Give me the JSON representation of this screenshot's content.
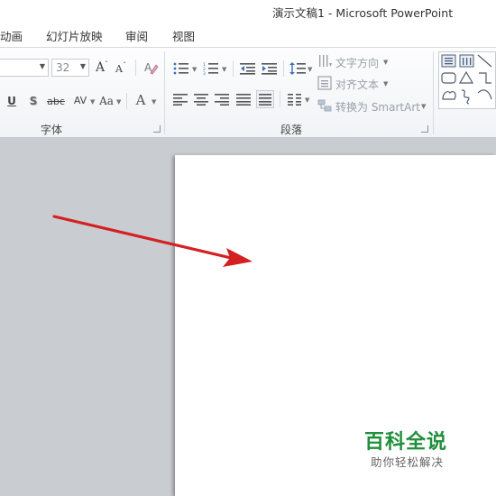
{
  "window": {
    "title": "演示文稿1 - Microsoft PowerPoint"
  },
  "tabs": [
    "动画",
    "幻灯片放映",
    "审阅",
    "视图"
  ],
  "font_group": {
    "label": "字体",
    "font_size": "32",
    "grow_font": "A",
    "shrink_font": "A",
    "underline": "U",
    "shadow": "S",
    "strikethrough": "abc",
    "spacing": "AV",
    "change_case": "Aa",
    "font_color": "A"
  },
  "paragraph_group": {
    "label": "段落",
    "text_direction": "文字方向",
    "align_text": "对齐文本",
    "convert_smartart": "转换为 SmartArt"
  },
  "watermark": {
    "title": "百科全说",
    "subtitle": "助你轻松解决"
  },
  "colors": {
    "arrow": "#d42020",
    "watermark": "#1f8f3a",
    "canvas": "#c9ccd1"
  },
  "icons": [
    "clear-format-icon",
    "bullets-icon",
    "numbering-icon",
    "decrease-indent-icon",
    "increase-indent-icon",
    "line-spacing-icon",
    "columns-icon",
    "shapes-gallery"
  ]
}
